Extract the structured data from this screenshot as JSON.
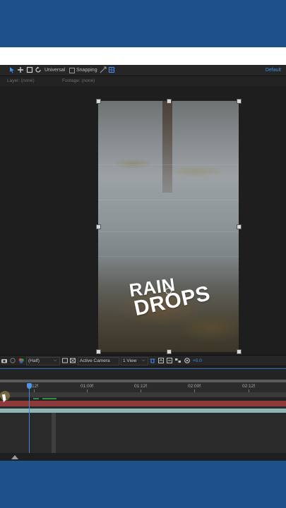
{
  "toolbar": {
    "axis_mode": "Universal",
    "snapping_label": "Snapping",
    "workspace": "Default"
  },
  "info": {
    "layer": "Layer: (none)",
    "footage": "Footage: (none)"
  },
  "composition": {
    "title_line1": "RAIN",
    "title_line2": "DROPS"
  },
  "viewer_bar": {
    "resolution": "(Half)",
    "camera": "Active Camera",
    "views": "1 View",
    "exposure": "+0.0"
  },
  "timeline": {
    "ruler_labels": [
      "12f",
      "01:00f",
      "01:12f",
      "02:00f",
      "02:12f"
    ]
  },
  "colors": {
    "accent": "#3a8ee6",
    "playhead": "#4d94ec",
    "track_red": "#8e3a3a",
    "track_teal": "#8fb5b5",
    "frame_blue": "#1e5089"
  }
}
